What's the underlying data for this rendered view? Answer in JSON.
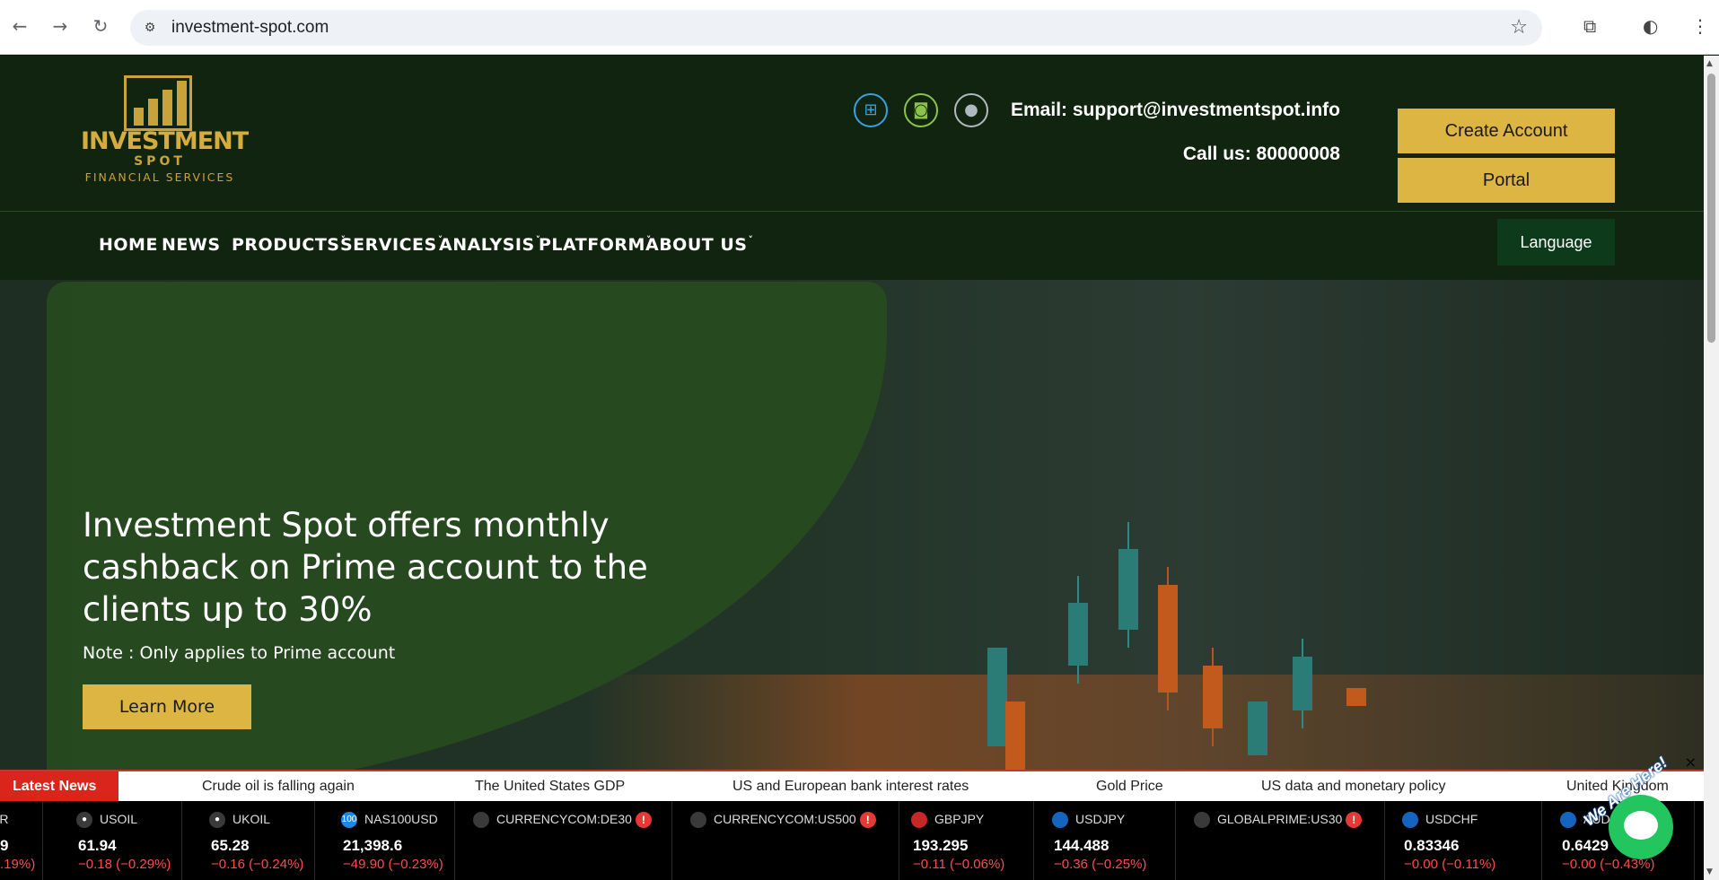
{
  "browser": {
    "url": "investment-spot.com",
    "icons": [
      "back-arrow-icon",
      "forward-arrow-icon",
      "reload-icon",
      "site-settings-icon",
      "bookmark-star-icon",
      "extensions-icon",
      "profile-icon",
      "menu-icon"
    ]
  },
  "header": {
    "logo": {
      "line1": "INVESTMENT",
      "line2": "SPOT",
      "line3": "FINANCIAL SERVICES"
    },
    "app_icons": [
      "windows-icon",
      "android-icon",
      "apple-icon"
    ],
    "email": "Email: support@investmentspot.info",
    "phone": "Call us: 80000008",
    "create_account": "Create Account",
    "portal": "Portal"
  },
  "nav": {
    "items": [
      {
        "label": "HOME",
        "has_dropdown": false
      },
      {
        "label": "NEWS",
        "has_dropdown": false
      },
      {
        "label": "PRODUCTS",
        "has_dropdown": true
      },
      {
        "label": "SERVICES",
        "has_dropdown": true
      },
      {
        "label": "ANALYSIS",
        "has_dropdown": true
      },
      {
        "label": "PLATFORM",
        "has_dropdown": true
      },
      {
        "label": "ABOUT US",
        "has_dropdown": true
      }
    ],
    "caret": "˅",
    "language": "Language"
  },
  "hero": {
    "title": "Investment Spot offers monthly cashback on Prime account to the clients up to 30%",
    "note": "Note : Only applies to Prime account",
    "cta": "Learn More"
  },
  "news": {
    "label": "Latest News",
    "items": [
      "Crude oil is falling again",
      "The United States GDP",
      "US and European bank interest rates",
      "Gold Price",
      "US data and monetary policy",
      "United Kingdom"
    ],
    "close": "×"
  },
  "ticker": [
    {
      "symbol": "ER",
      "price": "9",
      "change": ".19%)"
    },
    {
      "symbol": "USOIL",
      "price": "61.94",
      "change": "−0.18 (−0.29%)"
    },
    {
      "symbol": "UKOIL",
      "price": "65.28",
      "change": "−0.16 (−0.24%)"
    },
    {
      "symbol": "NAS100USD",
      "price": "21,398.6",
      "change": "−49.90 (−0.23%)"
    },
    {
      "symbol": "CURRENCYCOM:DE30",
      "price": "",
      "change": ""
    },
    {
      "symbol": "CURRENCYCOM:US500",
      "price": "",
      "change": ""
    },
    {
      "symbol": "GBPJPY",
      "price": "193.295",
      "change": "−0.11 (−0.06%)"
    },
    {
      "symbol": "USDJPY",
      "price": "144.488",
      "change": "−0.36 (−0.25%)"
    },
    {
      "symbol": "GLOBALPRIME:US30",
      "price": "",
      "change": ""
    },
    {
      "symbol": "USDCHF",
      "price": "0.83346",
      "change": "−0.00 (−0.11%)"
    },
    {
      "symbol": "AUD",
      "price": "0.6429",
      "change": "−0.00 (−0.43%)"
    }
  ],
  "chat": {
    "text": "We Are Here!"
  }
}
